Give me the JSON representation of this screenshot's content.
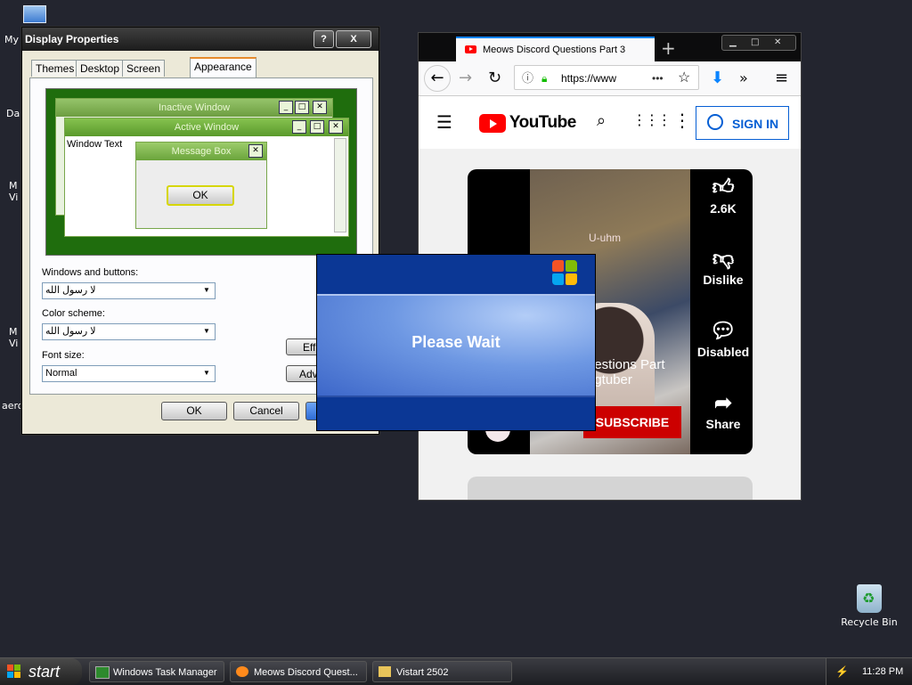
{
  "desktop": {
    "left_labels": [
      "My",
      "Da",
      "M\nVi",
      "M\nVi",
      "aero"
    ],
    "recycle_bin_label": "Recycle Bin"
  },
  "display_properties": {
    "title": "Display Properties",
    "help_button": "?",
    "close_button": "X",
    "tabs": [
      "Themes",
      "Desktop",
      "Screen Saver",
      "Appearance"
    ],
    "active_tab": "Appearance",
    "preview": {
      "inactive_title": "Inactive Window",
      "active_title": "Active Window",
      "window_text": "Window Text",
      "message_box_title": "Message Box",
      "ok_label": "OK"
    },
    "windows_and_buttons_label": "Windows and buttons:",
    "windows_and_buttons_value": "لا رسول الله",
    "color_scheme_label": "Color scheme:",
    "color_scheme_value": "لا رسول الله",
    "font_size_label": "Font size:",
    "font_size_value": "Normal",
    "effects_button": "Effe",
    "advanced_button": "Adv",
    "ok_button": "OK",
    "cancel_button": "Cancel"
  },
  "firefox": {
    "tab_title": "Meows Discord Questions Part 3",
    "new_tab_glyph": "+",
    "url": "https://www",
    "url_more": "•••",
    "youtube": {
      "logo_text": "YouTube",
      "sign_in_label": "SIGN IN",
      "likes": "2.6K",
      "dislike_label": "Dislike",
      "comments_label": "Disabled",
      "share_label": "Share",
      "video_overlay_text": "U-uhm",
      "video_title_line1": "uestions Part",
      "video_title_line2": "ngtuber",
      "subscribe_label": "SUBSCRIBE"
    }
  },
  "please_wait": {
    "message": "Please Wait"
  },
  "taskbar": {
    "start_label": "start",
    "tasks": [
      "Windows Task Manager",
      "Meows Discord Quest...",
      "Vistart 2502"
    ],
    "clock": "11:28 PM"
  },
  "colors": {
    "xp_green_theme": "#78a64b",
    "xp_blue": "#0b3795",
    "youtube_red": "#ff0000",
    "firefox_blue": "#0a84ff"
  }
}
